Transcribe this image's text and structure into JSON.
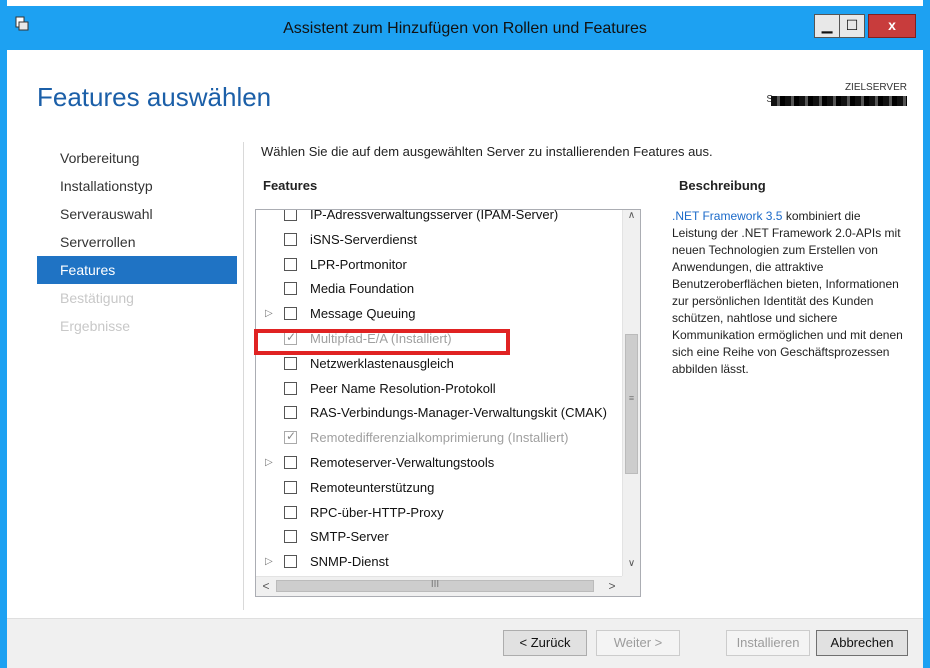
{
  "window": {
    "title": "Assistent zum Hinzufügen von Rollen und Features",
    "minimize": "▁",
    "maximize": "☐",
    "close": "x"
  },
  "page": {
    "heading": "Features auswählen",
    "target_label": "ZIELSERVER",
    "target_prefix": "S"
  },
  "nav": [
    {
      "label": "Vorbereitung",
      "state": "normal"
    },
    {
      "label": "Installationstyp",
      "state": "normal"
    },
    {
      "label": "Serverauswahl",
      "state": "normal"
    },
    {
      "label": "Serverrollen",
      "state": "normal"
    },
    {
      "label": "Features",
      "state": "active"
    },
    {
      "label": "Bestätigung",
      "state": "disabled"
    },
    {
      "label": "Ergebnisse",
      "state": "disabled"
    }
  ],
  "main": {
    "instruction": "Wählen Sie die auf dem ausgewählten Server zu installierenden Features aus.",
    "features_header": "Features",
    "description_header": "Beschreibung"
  },
  "features": [
    {
      "label": "IP-Adressverwaltungsserver (IPAM-Server)",
      "checked": false,
      "installed": false,
      "expand": ""
    },
    {
      "label": "iSNS-Serverdienst",
      "checked": false,
      "installed": false,
      "expand": ""
    },
    {
      "label": "LPR-Portmonitor",
      "checked": false,
      "installed": false,
      "expand": ""
    },
    {
      "label": "Media Foundation",
      "checked": false,
      "installed": false,
      "expand": ""
    },
    {
      "label": "Message Queuing",
      "checked": false,
      "installed": false,
      "expand": "▷"
    },
    {
      "label": "Multipfad-E/A (Installiert)",
      "checked": true,
      "installed": true,
      "expand": ""
    },
    {
      "label": "Netzwerklastenausgleich",
      "checked": false,
      "installed": false,
      "expand": ""
    },
    {
      "label": "Peer Name Resolution-Protokoll",
      "checked": false,
      "installed": false,
      "expand": ""
    },
    {
      "label": "RAS-Verbindungs-Manager-Verwaltungskit (CMAK)",
      "checked": false,
      "installed": false,
      "expand": ""
    },
    {
      "label": "Remotedifferenzialkomprimierung (Installiert)",
      "checked": true,
      "installed": true,
      "expand": ""
    },
    {
      "label": "Remoteserver-Verwaltungstools",
      "checked": false,
      "installed": false,
      "expand": "▷"
    },
    {
      "label": "Remoteunterstützung",
      "checked": false,
      "installed": false,
      "expand": ""
    },
    {
      "label": "RPC-über-HTTP-Proxy",
      "checked": false,
      "installed": false,
      "expand": ""
    },
    {
      "label": "SMTP-Server",
      "checked": false,
      "installed": false,
      "expand": ""
    },
    {
      "label": "SNMP-Dienst",
      "checked": false,
      "installed": false,
      "expand": "▷"
    }
  ],
  "scroll": {
    "up": "∧",
    "down": "∨",
    "left": "<",
    "right": ">",
    "grip_v": "≡",
    "grip_h": "III"
  },
  "description": {
    "link": ".NET Framework 3.5",
    "text": " kombiniert die Leistung der .NET Framework 2.0-APIs mit neuen Technologien zum Erstellen von Anwendungen, die attraktive Benutzeroberflächen bieten, Informationen zur persönlichen Identität des Kunden schützen, nahtlose und sichere Kommunikation ermöglichen und mit denen sich eine Reihe von Geschäftsprozessen abbilden lässt."
  },
  "buttons": {
    "back": "< Zurück",
    "next": "Weiter >",
    "install": "Installieren",
    "cancel": "Abbrechen"
  },
  "colors": {
    "titlebar": "#1da1f2",
    "nav_active": "#1f73c4",
    "heading": "#1b5fa8",
    "highlight": "#e02222",
    "link": "#1b6ac9"
  }
}
